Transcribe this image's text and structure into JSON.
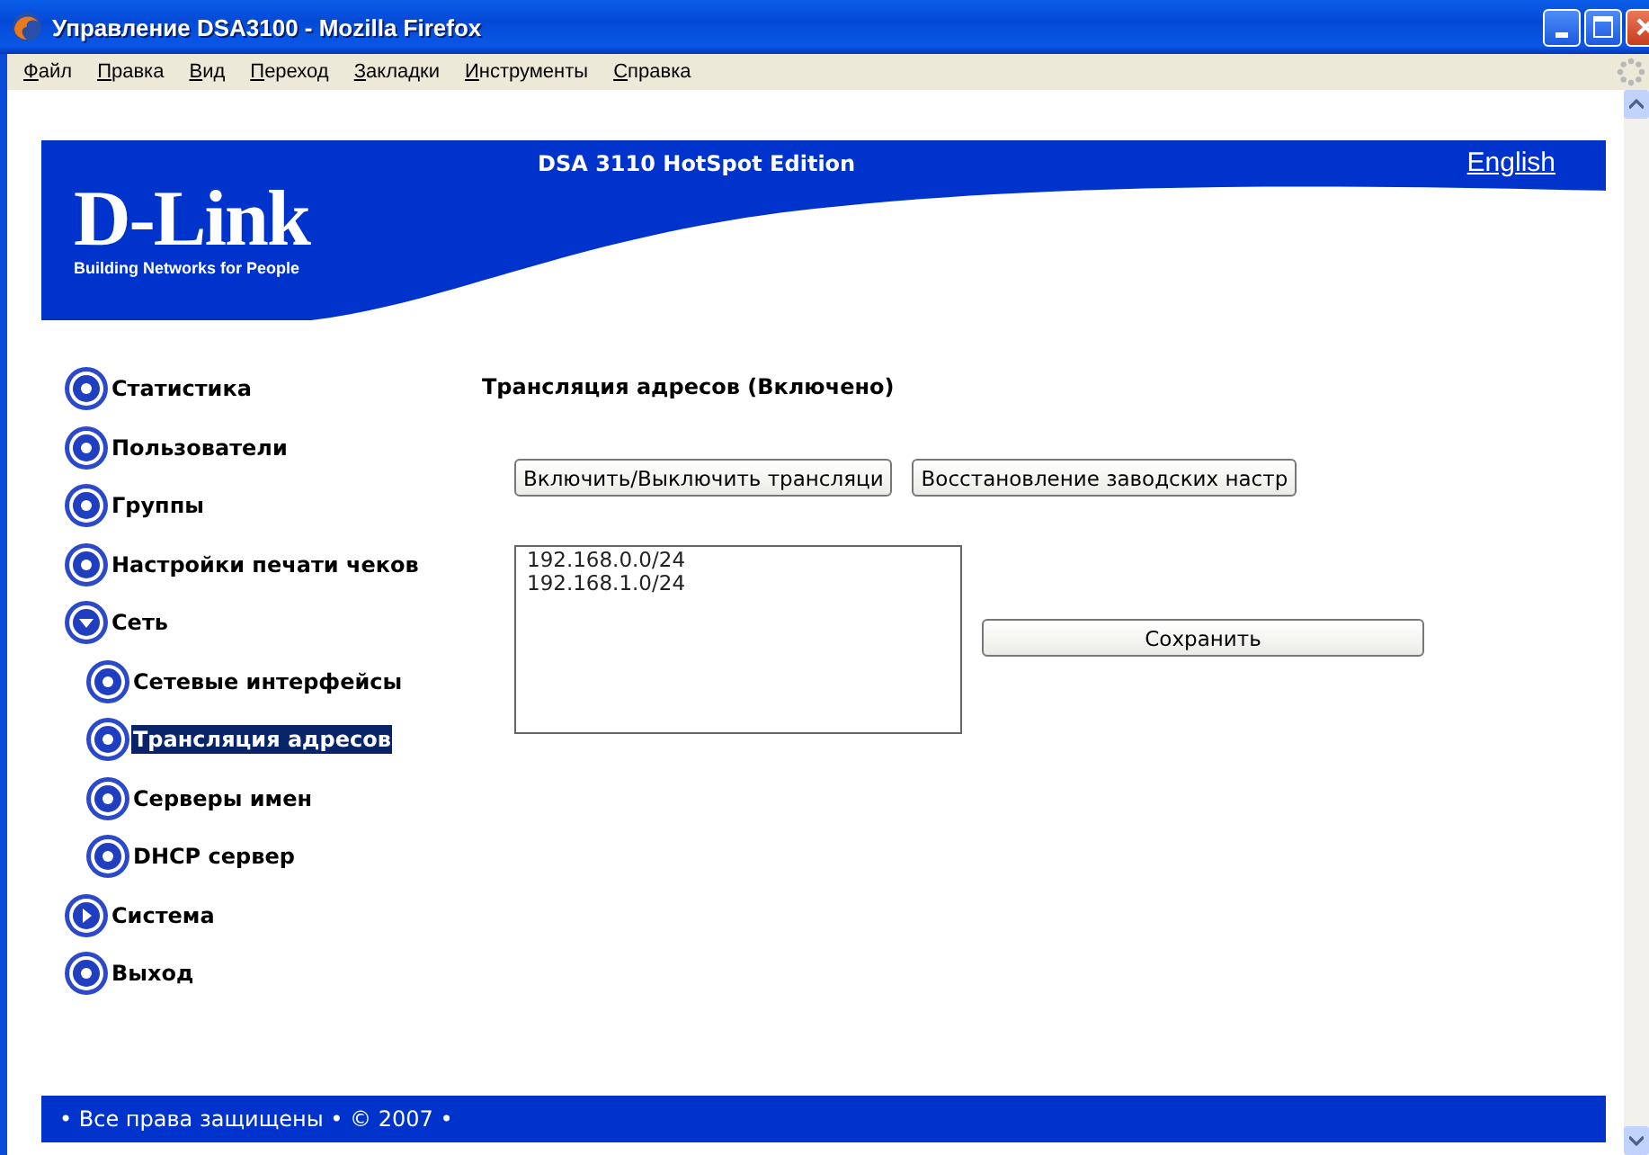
{
  "window": {
    "title": "Управление DSA3100 - Mozilla Firefox"
  },
  "menu": [
    "Файл",
    "Правка",
    "Вид",
    "Переход",
    "Закладки",
    "Инструменты",
    "Справка"
  ],
  "header": {
    "logo": "D-Link",
    "tagline": "Building Networks for People",
    "product": "DSA 3110 HotSpot Edition",
    "language_link": "English"
  },
  "sidebar": {
    "items": [
      {
        "label": "Статистика",
        "kind": "page",
        "selected": false
      },
      {
        "label": "Пользователи",
        "kind": "page",
        "selected": false
      },
      {
        "label": "Группы",
        "kind": "page",
        "selected": false
      },
      {
        "label": "Настройки печати чеков",
        "kind": "page",
        "selected": false
      },
      {
        "label": "Сеть",
        "kind": "folder",
        "expanded": true,
        "selected": false,
        "children": [
          {
            "label": "Сетевые интерфейсы",
            "kind": "page",
            "selected": false
          },
          {
            "label": "Трансляция адресов",
            "kind": "page",
            "selected": true
          },
          {
            "label": "Серверы имен",
            "kind": "page",
            "selected": false
          },
          {
            "label": "DHCP сервер",
            "kind": "page",
            "selected": false
          }
        ]
      },
      {
        "label": "Система",
        "kind": "folder",
        "expanded": false,
        "selected": false
      },
      {
        "label": "Выход",
        "kind": "page",
        "selected": false
      }
    ]
  },
  "main": {
    "title": "Трансляция адресов (Включено)",
    "toggle_button": "Включить/Выключить трансляци",
    "reset_button": "Восстановление заводских настр",
    "networks": [
      "192.168.0.0/24",
      "192.168.1.0/24"
    ],
    "save_button": "Сохранить"
  },
  "footer": "• Все права защищены • © 2007 •"
}
